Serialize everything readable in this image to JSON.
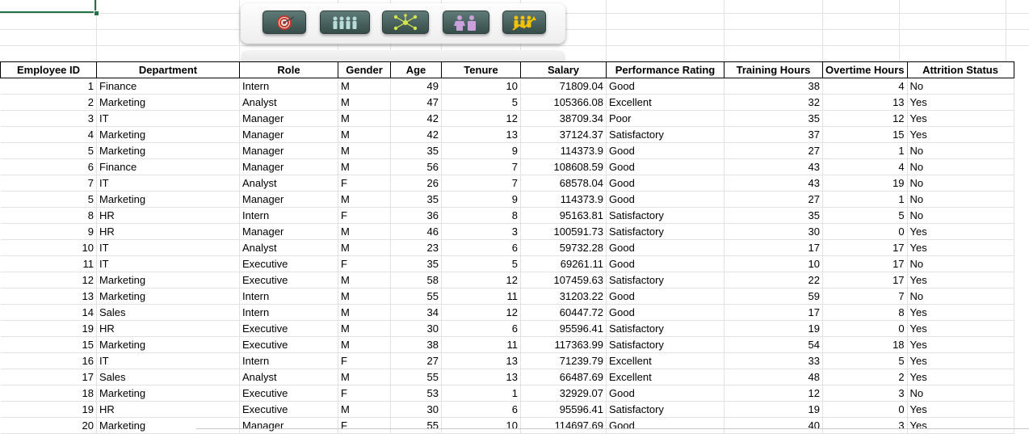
{
  "toolbar": {
    "buttons": [
      {
        "icon": "target-icon",
        "color": "#c0392b"
      },
      {
        "icon": "team-icon",
        "color": "#b7dcd9"
      },
      {
        "icon": "network-icon",
        "color": "#d5e64d"
      },
      {
        "icon": "people-pair-icon",
        "color": "#c9a0dc"
      },
      {
        "icon": "growth-chart-icon",
        "color": "#f2c200"
      }
    ]
  },
  "table": {
    "headers": [
      "Employee ID",
      "Department",
      "Role",
      "Gender",
      "Age",
      "Tenure",
      "Salary",
      "Performance Rating",
      "Training Hours",
      "Overtime Hours",
      "Attrition Status"
    ],
    "rows": [
      [
        "1",
        "Finance",
        "Intern",
        "M",
        "49",
        "10",
        "71809.04",
        "Good",
        "38",
        "4",
        "No"
      ],
      [
        "2",
        "Marketing",
        "Analyst",
        "M",
        "47",
        "5",
        "105366.08",
        "Excellent",
        "32",
        "13",
        "Yes"
      ],
      [
        "3",
        "IT",
        "Manager",
        "M",
        "42",
        "12",
        "38709.34",
        "Poor",
        "35",
        "12",
        "Yes"
      ],
      [
        "4",
        "Marketing",
        "Manager",
        "M",
        "42",
        "13",
        "37124.37",
        "Satisfactory",
        "37",
        "15",
        "Yes"
      ],
      [
        "5",
        "Marketing",
        "Manager",
        "M",
        "35",
        "9",
        "114373.9",
        "Good",
        "27",
        "1",
        "No"
      ],
      [
        "6",
        "Finance",
        "Manager",
        "M",
        "56",
        "7",
        "108608.59",
        "Good",
        "43",
        "4",
        "No"
      ],
      [
        "7",
        "IT",
        "Analyst",
        "F",
        "26",
        "7",
        "68578.04",
        "Good",
        "43",
        "19",
        "No"
      ],
      [
        "5",
        "Marketing",
        "Manager",
        "M",
        "35",
        "9",
        "114373.9",
        "Good",
        "27",
        "1",
        "No"
      ],
      [
        "8",
        "HR",
        "Intern",
        "F",
        "36",
        "8",
        "95163.81",
        "Satisfactory",
        "35",
        "5",
        "No"
      ],
      [
        "9",
        "HR",
        "Manager",
        "M",
        "46",
        "3",
        "100591.73",
        "Satisfactory",
        "30",
        "0",
        "Yes"
      ],
      [
        "10",
        "IT",
        "Analyst",
        "M",
        "23",
        "6",
        "59732.28",
        "Good",
        "17",
        "17",
        "Yes"
      ],
      [
        "11",
        "IT",
        "Executive",
        "F",
        "35",
        "5",
        "69261.11",
        "Good",
        "10",
        "17",
        "No"
      ],
      [
        "12",
        "Marketing",
        "Executive",
        "M",
        "58",
        "12",
        "107459.63",
        "Satisfactory",
        "22",
        "17",
        "Yes"
      ],
      [
        "13",
        "Marketing",
        "Intern",
        "M",
        "55",
        "11",
        "31203.22",
        "Good",
        "59",
        "7",
        "No"
      ],
      [
        "14",
        "Sales",
        "Intern",
        "M",
        "34",
        "12",
        "60447.72",
        "Good",
        "17",
        "8",
        "Yes"
      ],
      [
        "19",
        "HR",
        "Executive",
        "M",
        "30",
        "6",
        "95596.41",
        "Satisfactory",
        "19",
        "0",
        "Yes"
      ],
      [
        "15",
        "Marketing",
        "Executive",
        "M",
        "38",
        "11",
        "117363.99",
        "Satisfactory",
        "54",
        "18",
        "Yes"
      ],
      [
        "16",
        "IT",
        "Intern",
        "F",
        "27",
        "13",
        "71239.79",
        "Excellent",
        "33",
        "5",
        "Yes"
      ],
      [
        "17",
        "Sales",
        "Analyst",
        "M",
        "55",
        "13",
        "66487.69",
        "Excellent",
        "48",
        "2",
        "Yes"
      ],
      [
        "18",
        "Marketing",
        "Executive",
        "F",
        "53",
        "1",
        "32929.07",
        "Good",
        "12",
        "3",
        "No"
      ],
      [
        "19",
        "HR",
        "Executive",
        "M",
        "30",
        "6",
        "95596.41",
        "Satisfactory",
        "19",
        "0",
        "Yes"
      ],
      [
        "20",
        "Marketing",
        "Manager",
        "F",
        "55",
        "10",
        "114697.69",
        "Good",
        "40",
        "3",
        "Yes"
      ]
    ]
  }
}
